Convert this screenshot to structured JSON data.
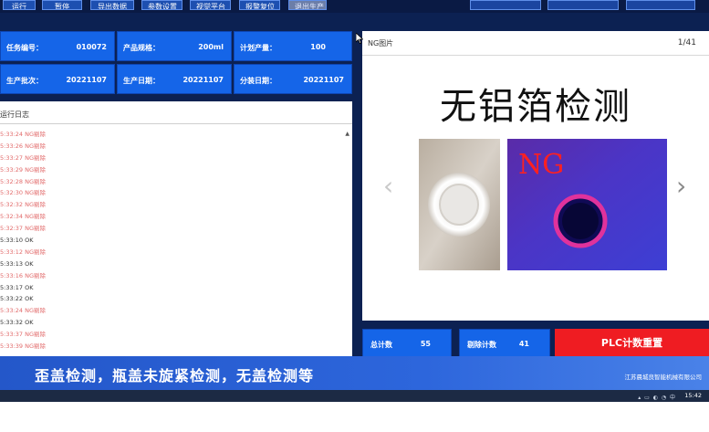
{
  "toolbar": {
    "buttons": [
      "运行",
      "暂停",
      "导出数据",
      "参数设置",
      "视觉平台",
      "报警复位",
      "退出生产"
    ]
  },
  "info": {
    "task_no_label": "任务编号：",
    "task_no": "010072",
    "spec_label": "产品规格：",
    "spec": "200ml",
    "plan_label": "计划产量：",
    "plan": "100",
    "batch_label": "生产批次：",
    "batch": "20221107",
    "prod_date_label": "生产日期：",
    "prod_date": "20221107",
    "pack_date_label": "分装日期：",
    "pack_date": "20221107"
  },
  "log": {
    "title": "运行日志",
    "items": [
      {
        "time": "5:33:24",
        "status": "NG剔除"
      },
      {
        "time": "5:33:26",
        "status": "NG剔除"
      },
      {
        "time": "5:33:27",
        "status": "NG剔除"
      },
      {
        "time": "5:33:29",
        "status": "NG剔除"
      },
      {
        "time": "5:32:28",
        "status": "NG剔除"
      },
      {
        "time": "5:32:30",
        "status": "NG剔除"
      },
      {
        "time": "5:32:32",
        "status": "NG剔除"
      },
      {
        "time": "5:32:34",
        "status": "NG剔除"
      },
      {
        "time": "5:32:37",
        "status": "NG剔除"
      },
      {
        "time": "5:33:10",
        "status": "OK"
      },
      {
        "time": "5:33:12",
        "status": "NG剔除"
      },
      {
        "time": "5:33:13",
        "status": "OK"
      },
      {
        "time": "5:33:16",
        "status": "NG剔除"
      },
      {
        "time": "5:33:17",
        "status": "OK"
      },
      {
        "time": "5:33:22",
        "status": "OK"
      },
      {
        "time": "5:33:24",
        "status": "NG剔除"
      },
      {
        "time": "5:33:32",
        "status": "OK"
      },
      {
        "time": "5:33:37",
        "status": "NG剔除"
      },
      {
        "time": "5:33:39",
        "status": "NG剔除"
      }
    ]
  },
  "image_panel": {
    "label": "NG图片",
    "counter": "1/41",
    "heading": "无铝箔检测",
    "overlay_text": "NG"
  },
  "counters": {
    "total_label": "总计数",
    "total": "55",
    "reject_label": "剔除计数",
    "reject": "41",
    "reset_label": "PLC计数重置"
  },
  "subtitle": "歪盖检测，瓶盖未旋紧检测，无盖检测等",
  "company": "江苏晨城良智能机械有限公司",
  "clock": "15:42",
  "colors": {
    "panel_blue": "#1565e8",
    "reset_red": "#ef1c22",
    "ng_text": "#e26b6b",
    "background": "#0c2152"
  }
}
